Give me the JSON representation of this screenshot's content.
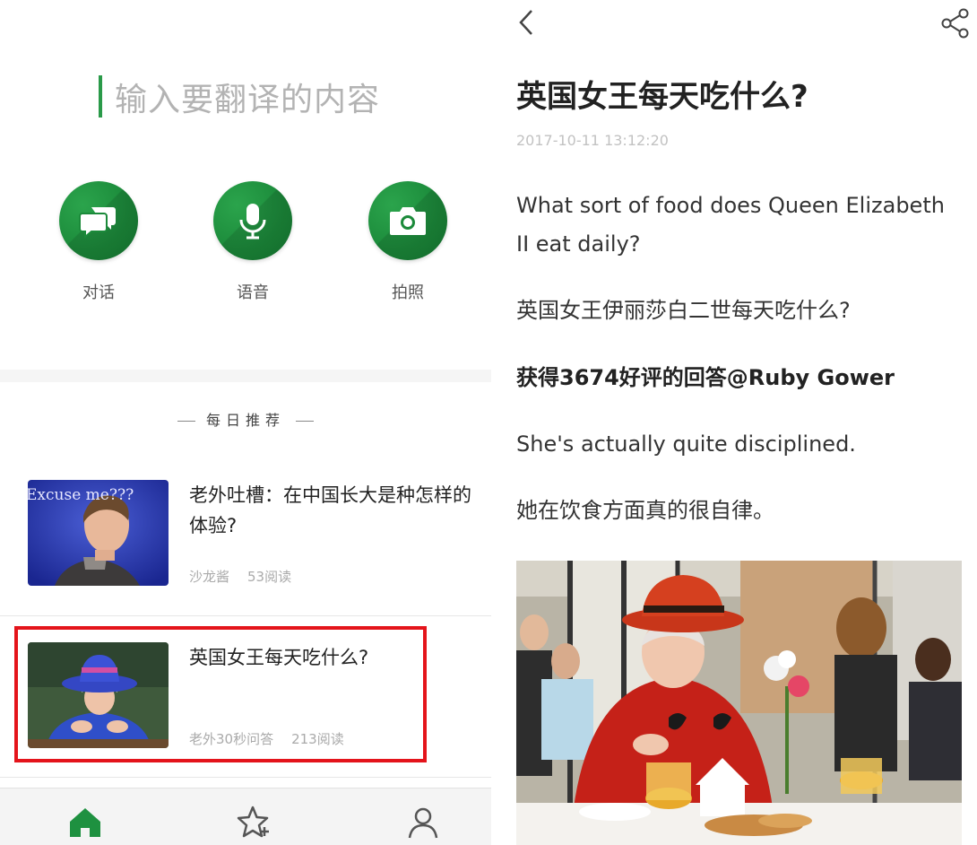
{
  "translate": {
    "placeholder": "输入要翻译的内容",
    "modes": [
      {
        "label": "对话",
        "icon": "chat-bubbles-icon"
      },
      {
        "label": "语音",
        "icon": "microphone-icon"
      },
      {
        "label": "拍照",
        "icon": "camera-icon"
      }
    ]
  },
  "daily": {
    "section_title": "每日推荐",
    "articles": [
      {
        "title": "老外吐槽：在中国长大是种怎样的体验?",
        "author": "沙龙酱",
        "reads": "53阅读",
        "thumb_text": "Excuse me???"
      },
      {
        "title": "英国女王每天吃什么?",
        "author": "老外30秒问答",
        "reads": "213阅读"
      }
    ]
  },
  "tabbar": [
    "home-icon",
    "star-plus-icon",
    "profile-icon"
  ],
  "detail": {
    "title": "英国女王每天吃什么?",
    "date": "2017-10-11 13:12:20",
    "paragraphs": [
      "What sort of food does Queen Elizabeth II eat daily?",
      "英国女王伊丽莎白二世每天吃什么?",
      "获得3674好评的回答@Ruby Gower",
      "She's actually quite disciplined.",
      "她在饮食方面真的很自律。"
    ]
  },
  "colors": {
    "accent": "#1e9140",
    "highlight": "#e4141b"
  }
}
